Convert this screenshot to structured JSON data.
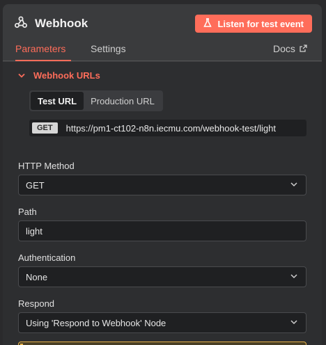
{
  "header": {
    "title": "Webhook",
    "listen_label": "Listen for test event"
  },
  "tabs": [
    {
      "label": "Parameters",
      "active": true
    },
    {
      "label": "Settings",
      "active": false
    }
  ],
  "docs_label": "Docs",
  "webhook_urls": {
    "section_label": "Webhook URLs",
    "segments": [
      {
        "label": "Test URL",
        "active": true
      },
      {
        "label": "Production URL",
        "active": false
      }
    ],
    "method_badge": "GET",
    "url": "https://pm1-ct102-n8n.iecmu.com/webhook-test/light"
  },
  "fields": {
    "http_method": {
      "label": "HTTP Method",
      "value": "GET"
    },
    "path": {
      "label": "Path",
      "value": "light"
    },
    "authentication": {
      "label": "Authentication",
      "value": "None"
    },
    "respond": {
      "label": "Respond",
      "value": "Using 'Respond to Webhook' Node"
    }
  },
  "colors": {
    "accent": "#ff6d5a",
    "warning": "#e6b24a"
  },
  "icons": {
    "node": "webhook-icon",
    "listen": "flask-icon",
    "docs": "external-link-icon",
    "collapse": "chevron-down-icon",
    "select": "chevron-down-icon"
  }
}
